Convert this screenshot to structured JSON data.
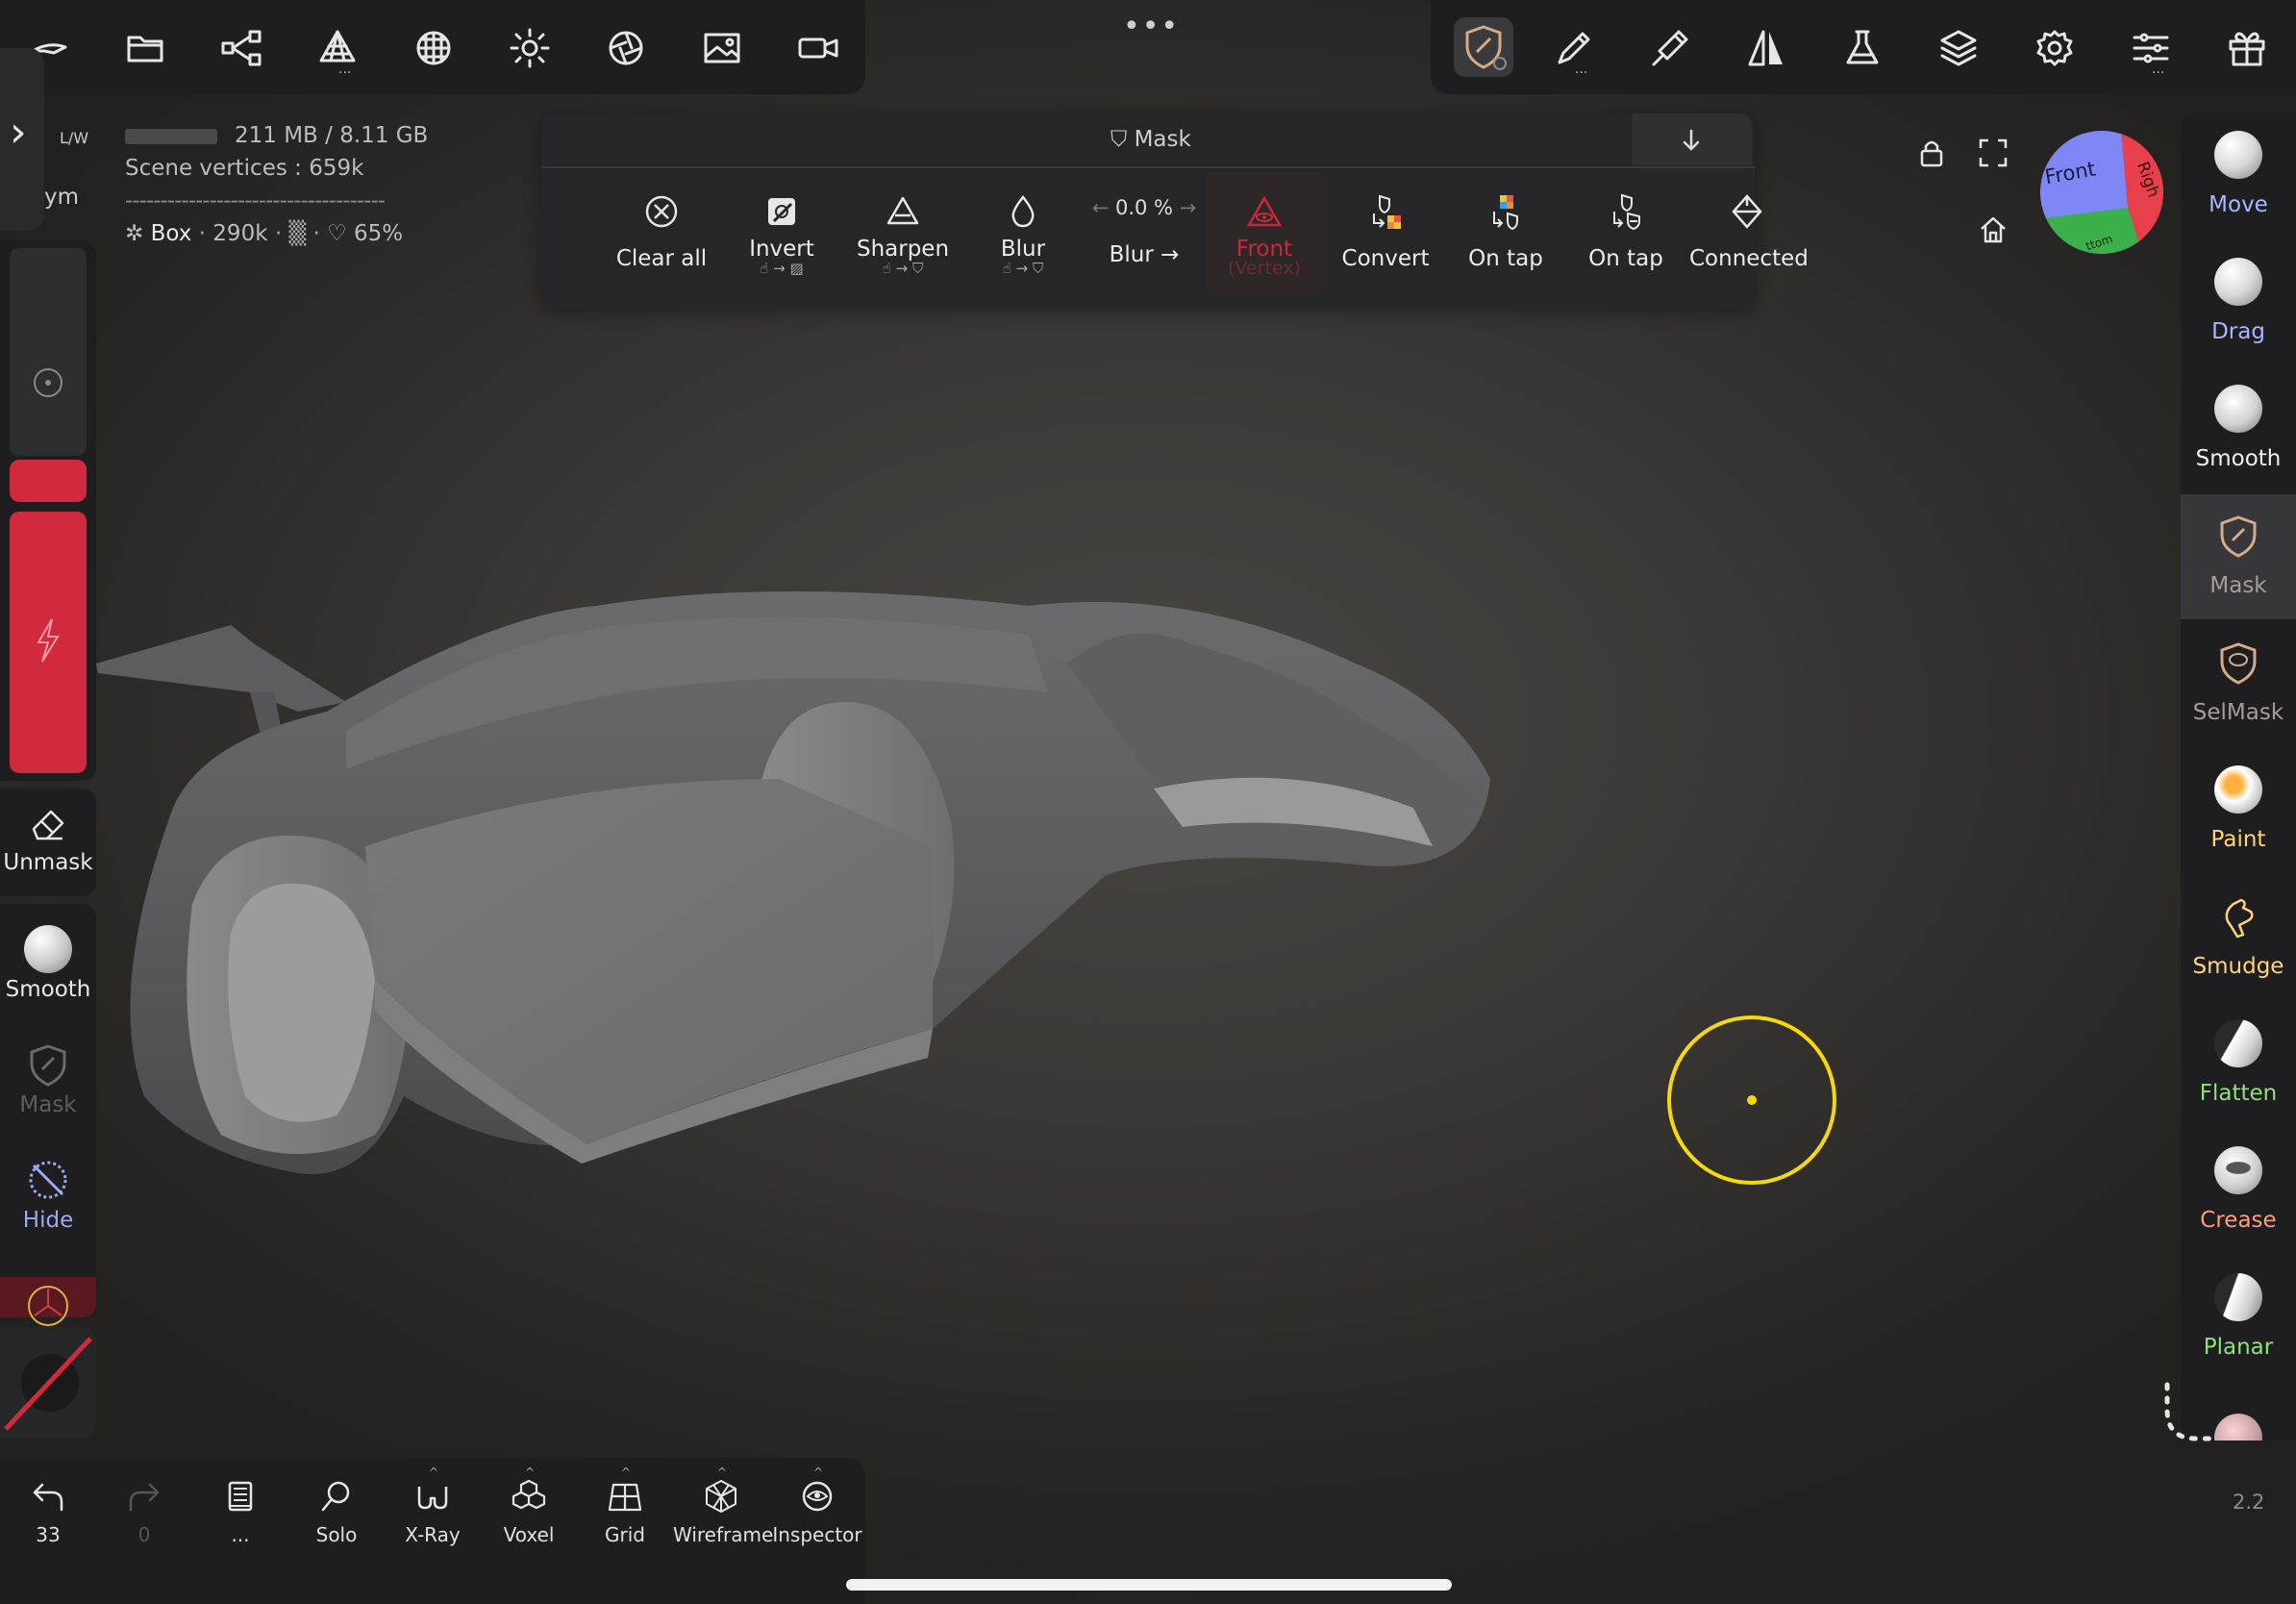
{
  "top_toolbar_left": {
    "icons": [
      "scene-icon",
      "folder-icon",
      "share-icon",
      "mesh-icon",
      "sphere-icon",
      "light-icon",
      "camera-lens-icon",
      "image-icon",
      "video-icon"
    ]
  },
  "top_toolbar_right": {
    "icons": [
      "mask-tool-icon",
      "brush-icon",
      "pen-icon",
      "symmetry-icon",
      "flask-icon",
      "layers-icon",
      "settings-icon",
      "sliders-icon",
      "gift-icon"
    ]
  },
  "stats": {
    "memory": "211 MB / 8.11 GB",
    "scene_vertices": "Scene vertices :  659k",
    "separator": "-------------------------------------",
    "object": "Box · 290k · ▒ · ♡ 65%",
    "object_name": "Box",
    "object_verts": "290k",
    "mask_pct": "65%"
  },
  "mask_panel": {
    "title": "Mask",
    "tools": [
      {
        "label": "Clear all",
        "sub": ""
      },
      {
        "label": "Invert",
        "sub": "☝ → ▨"
      },
      {
        "label": "Sharpen",
        "sub": "☝ → ⛉"
      },
      {
        "label": "Blur",
        "sub": "☝ → ⛉"
      },
      {
        "label": "Blur →",
        "sub": "",
        "value": "0.0 %"
      },
      {
        "label": "Front",
        "sub": "(Vertex)"
      },
      {
        "label": "Convert",
        "sub": ""
      },
      {
        "label": "On tap",
        "sub": ""
      },
      {
        "label": "On tap",
        "sub": ""
      },
      {
        "label": "Connected",
        "sub": ""
      }
    ]
  },
  "left_panel": {
    "sym_label": "ym",
    "lw_label": "L/W",
    "tools": [
      {
        "label": "Unmask"
      },
      {
        "label": "Smooth"
      },
      {
        "label": "Mask"
      },
      {
        "label": "Hide"
      }
    ]
  },
  "right_panel": {
    "tools": [
      {
        "label": "Move",
        "color": "#a9b5ff"
      },
      {
        "label": "Drag",
        "color": "#a9b5ff"
      },
      {
        "label": "Smooth",
        "color": "#f0f0f0"
      },
      {
        "label": "Mask",
        "color": "#a89a9a"
      },
      {
        "label": "SelMask",
        "color": "#a89a9a"
      },
      {
        "label": "Paint",
        "color": "#ffd37a"
      },
      {
        "label": "Smudge",
        "color": "#ffd37a"
      },
      {
        "label": "Flatten",
        "color": "#8fe07d"
      },
      {
        "label": "Crease",
        "color": "#ff9c7d"
      },
      {
        "label": "Planar",
        "color": "#8fe07d"
      }
    ]
  },
  "gizmo": {
    "front": "Front",
    "right": "Righ",
    "bottom": "ttom"
  },
  "bottom_toolbar": {
    "items": [
      {
        "label": "33"
      },
      {
        "label": "0"
      },
      {
        "label": "..."
      },
      {
        "label": "Solo"
      },
      {
        "label": "X-Ray"
      },
      {
        "label": "Voxel"
      },
      {
        "label": "Grid"
      },
      {
        "label": "Wireframe"
      },
      {
        "label": "Inspector"
      }
    ]
  },
  "version": "2.2",
  "colors": {
    "accent_red": "#d12a3e",
    "cursor_yellow": "#f5d90a",
    "panel_bg": "#1e1e20"
  }
}
